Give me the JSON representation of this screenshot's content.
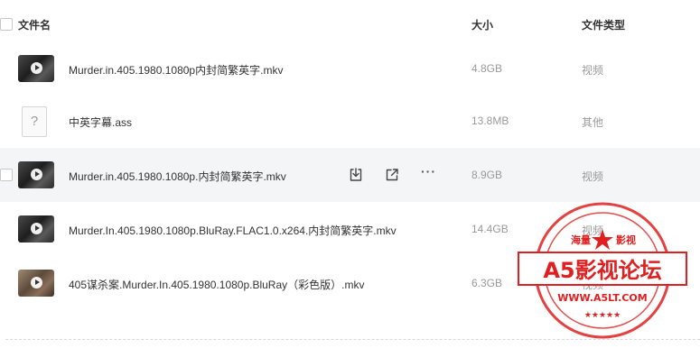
{
  "header": {
    "col_name": "文件名",
    "col_size": "大小",
    "col_type": "文件类型"
  },
  "files": [
    {
      "name": "Murder.in.405.1980.1080p内封简繁英字.mkv",
      "size": "4.8GB",
      "type": "视频",
      "icon": "video-thumbnail-icon"
    },
    {
      "name": "中英字幕.ass",
      "size": "13.8MB",
      "type": "其他",
      "icon": "unknown-file-icon"
    },
    {
      "name": "Murder.in.405.1980.1080p.内封简繁英字.mkv",
      "size": "8.9GB",
      "type": "视频",
      "icon": "video-thumbnail-icon"
    },
    {
      "name": "Murder.In.405.1980.1080p.BluRay.FLAC1.0.x264.内封简繁英字.mkv",
      "size": "14.4GB",
      "type": "视频",
      "icon": "video-thumbnail-icon"
    },
    {
      "name": "405谋杀案.Murder.In.405.1980.1080p.BluRay（彩色版）.mkv",
      "size": "6.3GB",
      "type": "视频",
      "icon": "video-thumbnail-icon"
    }
  ],
  "row_actions": {
    "download_icon": "download-icon",
    "share_icon": "share-icon",
    "more_label": "···"
  },
  "watermark": {
    "top_left": "海量",
    "top_right": "影视",
    "main": "A5影视论坛",
    "url": "WWW.A5LT.COM",
    "color": "#e02020"
  }
}
